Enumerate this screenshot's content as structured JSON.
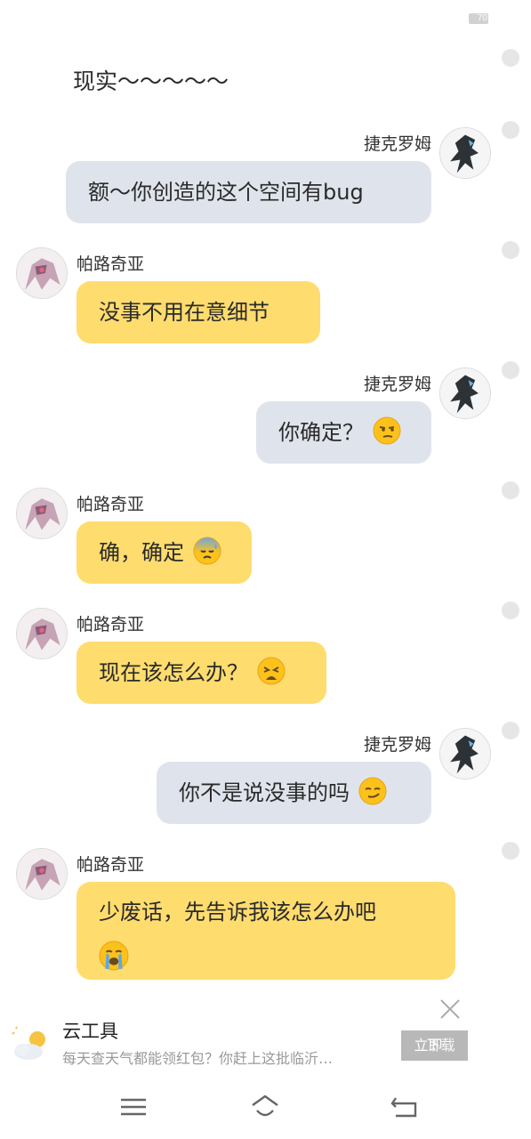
{
  "status_bar": {
    "battery": "70"
  },
  "narration": "现实～～～～～",
  "characters": {
    "jekrom": "捷克罗姆",
    "palkia": "帕路奇亚"
  },
  "messages": [
    {
      "speaker": "捷克罗姆",
      "side": "right",
      "text": "额～你创造的这个空间有bug"
    },
    {
      "speaker": "帕路奇亚",
      "side": "left",
      "text": "没事不用在意细节"
    },
    {
      "speaker": "捷克罗姆",
      "side": "right",
      "text": "你确定？",
      "emoji": "unamused-face"
    },
    {
      "speaker": "帕路奇亚",
      "side": "left",
      "text": "确，确定",
      "emoji": "anxious-face-with-sweat"
    },
    {
      "speaker": "帕路奇亚",
      "side": "left",
      "text": "现在该怎么办？",
      "emoji": "weary-face"
    },
    {
      "speaker": "捷克罗姆",
      "side": "right",
      "text": "你不是说没事的吗",
      "emoji": "smirking-face"
    },
    {
      "speaker": "帕路奇亚",
      "side": "left",
      "text": "少废话，先告诉我该怎么办吧",
      "emoji": "loudly-crying-face"
    }
  ],
  "ad": {
    "title": "云工具",
    "text": "每天查天气都能领红包？你赶上这批临沂…",
    "button": "立即",
    "button_overlay": "下载",
    "icon": "weather-icon"
  },
  "nav": {
    "menu": "menu-icon",
    "home": "home-icon",
    "back": "back-icon"
  },
  "colors": {
    "bubble_right": "#dfe4ec",
    "bubble_left": "#fedc6e",
    "select_dot": "#e6e6e6"
  }
}
